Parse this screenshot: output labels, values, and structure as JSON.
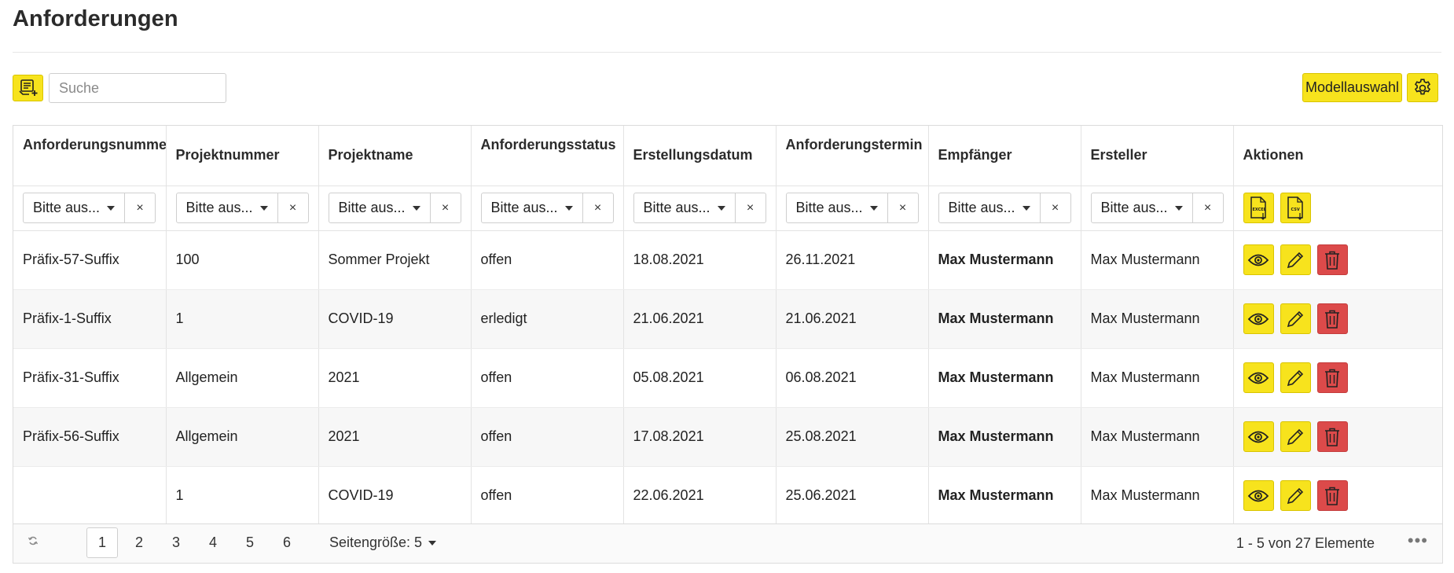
{
  "page": {
    "title": "Anforderungen"
  },
  "toolbar": {
    "search_placeholder": "Suche",
    "model_button": "Modellauswahl",
    "add_icon": "add-request-icon",
    "settings_icon": "gear-icon",
    "accent_color": "#f7e31d",
    "danger_color": "#dc4a4a"
  },
  "columns": [
    "Anforderungsnummer",
    "Projektnummer",
    "Projektname",
    "Anforderungsstatus",
    "Erstellungsdatum",
    "Anforderungstermin",
    "Empfänger",
    "Ersteller",
    "Aktionen"
  ],
  "filter_placeholder": "Bitte aus...",
  "filter_clear": "×",
  "export": {
    "excel_label": "EXCEL",
    "csv_label": "CSV"
  },
  "rows": [
    {
      "nummer": "Präfix-57-Suffix",
      "projektnummer": "100",
      "projektname": "Sommer Projekt",
      "status": "offen",
      "erstellt": "18.08.2021",
      "termin": "26.11.2021",
      "empfaenger": "Max Mustermann",
      "ersteller": "Max Mustermann"
    },
    {
      "nummer": "Präfix-1-Suffix",
      "projektnummer": "1",
      "projektname": "COVID-19",
      "status": "erledigt",
      "erstellt": "21.06.2021",
      "termin": "21.06.2021",
      "empfaenger": "Max Mustermann",
      "ersteller": "Max Mustermann"
    },
    {
      "nummer": "Präfix-31-Suffix",
      "projektnummer": "Allgemein",
      "projektname": "2021",
      "status": "offen",
      "erstellt": "05.08.2021",
      "termin": "06.08.2021",
      "empfaenger": "Max Mustermann",
      "ersteller": "Max Mustermann"
    },
    {
      "nummer": "Präfix-56-Suffix",
      "projektnummer": "Allgemein",
      "projektname": "2021",
      "status": "offen",
      "erstellt": "17.08.2021",
      "termin": "25.08.2021",
      "empfaenger": "Max Mustermann",
      "ersteller": "Max Mustermann"
    },
    {
      "nummer": "",
      "projektnummer": "1",
      "projektname": "COVID-19",
      "status": "offen",
      "erstellt": "22.06.2021",
      "termin": "25.06.2021",
      "empfaenger": "Max Mustermann",
      "ersteller": "Max Mustermann"
    }
  ],
  "pager": {
    "refresh_icon": "refresh-icon",
    "pages": [
      "1",
      "2",
      "3",
      "4",
      "5",
      "6"
    ],
    "current_page": "1",
    "page_size_label": "Seitengröße: 5",
    "info": "1 - 5 von 27 Elemente",
    "more": "•••"
  }
}
